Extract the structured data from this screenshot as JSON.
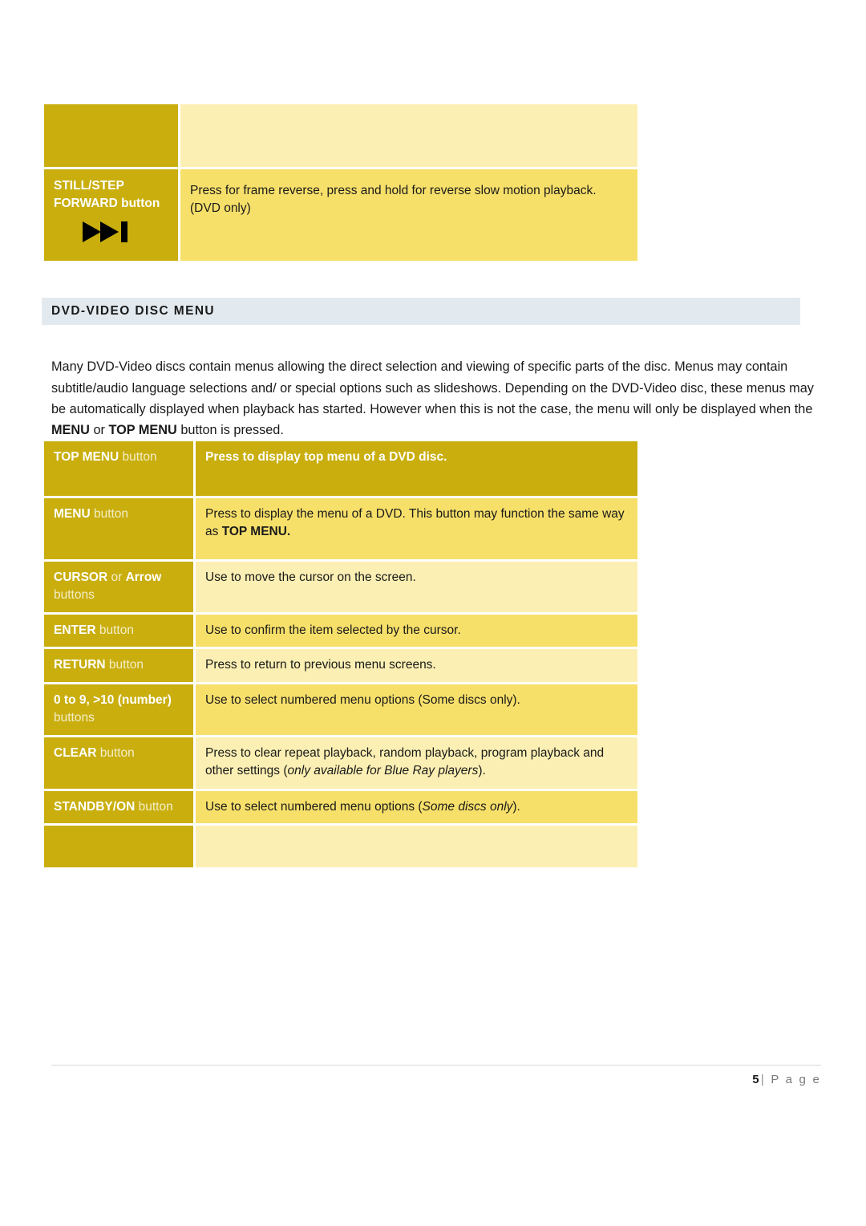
{
  "document": {
    "page_label_number": "5",
    "page_label_separator": "|",
    "page_label_word": "P a g e"
  },
  "top_table": {
    "header_row": {
      "label": "",
      "description": ""
    },
    "rows": [
      {
        "label_line1_strong": "STILL/STEP",
        "label_line2_strong": "FORWARD",
        "label_line2_soft": " button",
        "icon": "skip-forward-icon",
        "description": "Press for frame reverse, press and hold for reverse slow motion playback. (DVD only)"
      }
    ]
  },
  "section": {
    "heading": "DVD-VIDEO DISC MENU",
    "paragraph_part1": "Many DVD-Video discs contain menus allowing the direct selection and viewing of specific parts of the disc. Menus may contain subtitle/audio language selections and/ or special options such as slideshows. Depending on the DVD-Video disc, these menus may be automatically displayed when playback has started. However when this is not the case, the menu will only be displayed when the ",
    "paragraph_bold1": "MENU",
    "paragraph_mid": " or ",
    "paragraph_bold2": "TOP MENU",
    "paragraph_part2": " button is pressed."
  },
  "menu_table": {
    "rows": [
      {
        "name": "top-menu",
        "label_strong": "TOP MENU",
        "label_soft": " button",
        "description": "Press to display top menu of a DVD disc.",
        "description_bold": true,
        "label_bg": "#c9ae0e",
        "desc_bg": "#c9ae0e"
      },
      {
        "name": "menu",
        "label_strong": "MENU",
        "label_soft": " button",
        "description_pre": "Press to display the menu of a DVD. This button may function the same way as ",
        "description_bold_part": "TOP MENU.",
        "label_bg": "#c9ae0e",
        "desc_bg": "#f7e06a"
      },
      {
        "name": "cursor",
        "label_strong": "CURSOR",
        "label_mid": " or ",
        "label_strong2": "Arrow",
        "label_soft": "buttons",
        "description": "Use to move the cursor on the screen.",
        "label_bg": "#c9ae0e",
        "desc_bg": "#fbefb3"
      },
      {
        "name": "enter",
        "label_strong": "ENTER",
        "label_soft": " button",
        "description": "Use to confirm the item selected by the cursor.",
        "label_bg": "#c9ae0e",
        "desc_bg": "#f7e06a"
      },
      {
        "name": "return",
        "label_strong": "RETURN",
        "label_soft": " button",
        "description": "Press to return to previous menu screens.",
        "label_bg": "#c9ae0e",
        "desc_bg": "#fbefb3"
      },
      {
        "name": "number",
        "label_strong": "0 to 9, >10 (number)",
        "label_soft": "buttons",
        "description": "Use to select numbered menu options (Some discs only).",
        "label_bg": "#c9ae0e",
        "desc_bg": "#f7e06a"
      },
      {
        "name": "clear",
        "label_strong": "CLEAR",
        "label_soft": " button",
        "description_pre": "Press to clear repeat playback, random playback, program playback and other settings (",
        "description_italic": "only available for Blue Ray players",
        "description_post": ").",
        "label_bg": "#c9ae0e",
        "desc_bg": "#fbefb3"
      },
      {
        "name": "standby-on",
        "label_strong": "STANDBY/ON",
        "label_soft": " button",
        "description_pre": "Use to select numbered menu options (",
        "description_italic": "Some discs only",
        "description_post": ").",
        "label_bg": "#c9ae0e",
        "desc_bg": "#f7e06a"
      },
      {
        "name": "blank",
        "label_strong": "",
        "label_soft": "",
        "description": "",
        "label_bg": "#c9ae0e",
        "desc_bg": "#fbefb3"
      }
    ]
  },
  "colors": {
    "gold": "#c9ae0e",
    "yellow_medium": "#f7e06a",
    "yellow_light": "#fbefb3",
    "heading_bg": "#e3eaef",
    "text": "#1a1a1a"
  }
}
